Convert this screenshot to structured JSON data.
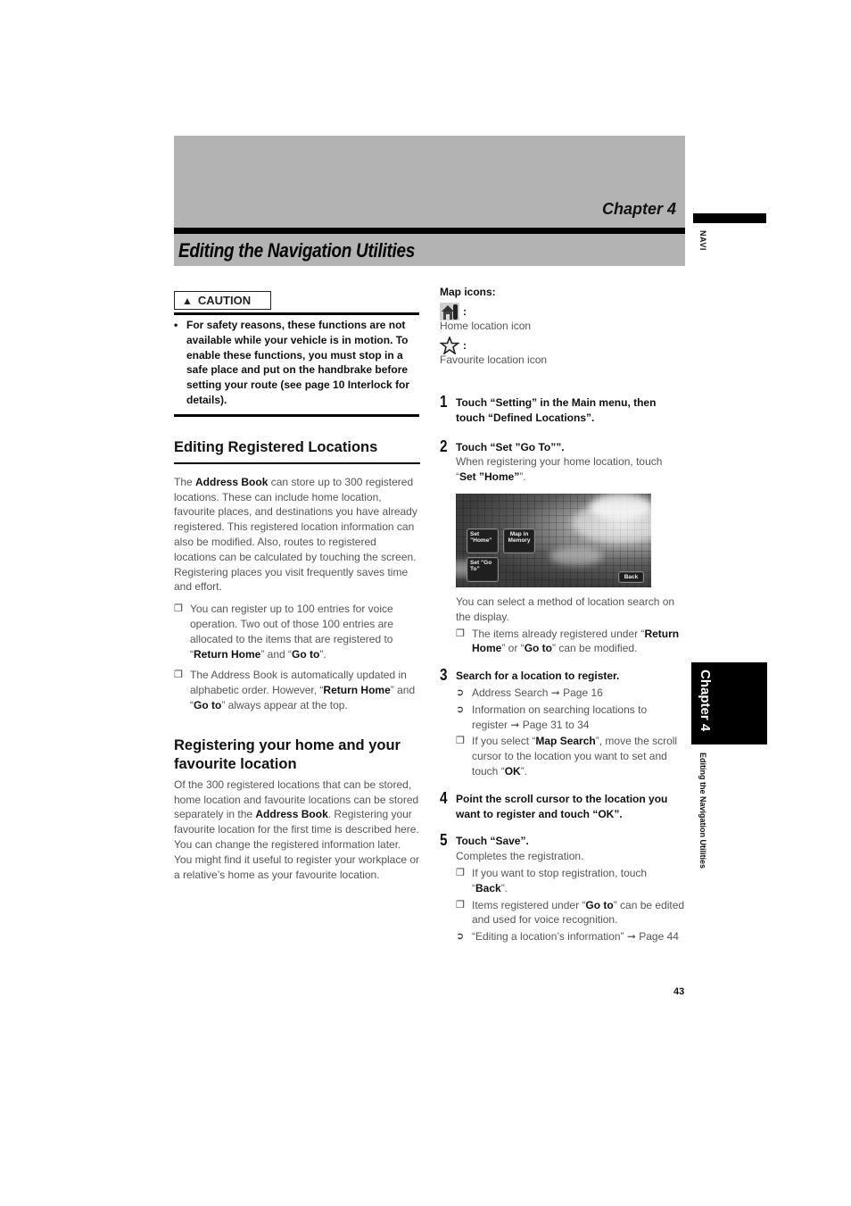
{
  "header": {
    "chapter": "Chapter 4",
    "title": "Editing the Navigation Utilities"
  },
  "side_tab": {
    "navi": "NAVI",
    "chapter": "Chapter 4",
    "section": "Editing the Navigation Utilities"
  },
  "caution": {
    "label": "CAUTION",
    "icon": "warning-triangle-icon",
    "text": "For safety reasons, these functions are not available while your vehicle is in motion. To enable these functions, you must stop in a safe place and put on the handbrake before setting your route (see page 10 Interlock for details)."
  },
  "section1": {
    "heading": "Editing Registered Locations",
    "intro_pre": "The ",
    "intro_bold": "Address Book",
    "intro_post": " can store up to 300 registered locations. These can include home location, favourite places, and destinations you have already registered. This registered location information can also be modified. Also, routes to registered locations can be calculated by touching the screen. Registering places you visit frequently saves time and effort.",
    "notes": [
      {
        "mark": "❐",
        "t1": "You can register up to 100 entries for voice operation. Two out of those 100 entries are allocated to the items that are registered to “",
        "b1": "Return Home",
        "t2": "” and “",
        "b2": "Go to",
        "t3": "”."
      },
      {
        "mark": "❐",
        "t1": "The Address Book is automatically updated in alphabetic order. However, “",
        "b1": "Return Home",
        "t2": "” and “",
        "b2": "Go to",
        "t3": "” always appear at the top."
      }
    ]
  },
  "section2": {
    "heading": "Registering your home and your favourite location",
    "t1": "Of the 300 registered locations that can be stored, home location and favourite locations can be stored separately in the ",
    "b1": "Address Book",
    "t2": ". Registering your favourite location for the first time is described here. You can change the registered information later. You might find it useful to register your workplace or a relative’s home as your favourite location."
  },
  "map_icons": {
    "title": "Map icons:",
    "items": [
      {
        "icon": "home-location-icon",
        "colon": ":",
        "caption": "Home location icon"
      },
      {
        "icon": "favourite-star-icon",
        "colon": ":",
        "caption": "Favourite location icon"
      }
    ]
  },
  "steps": [
    {
      "num": "1",
      "title": "Touch “Setting” in the Main menu, then touch “Defined Locations”."
    },
    {
      "num": "2",
      "title": "Touch “Set ”Go To””.",
      "desc_pre": "When registering your home location, touch “",
      "desc_bold": "Set ”Home”",
      "desc_post": "”.",
      "after_screen": "You can select a method of location search on the display.",
      "note": {
        "mark": "❐",
        "t1": "The items already registered under “",
        "b1": "Return Home",
        "t2": "” or “",
        "b2": "Go to",
        "t3": "” can be modified."
      }
    },
    {
      "num": "3",
      "title": "Search for a location to register.",
      "refs": [
        {
          "mark": "➲",
          "text": "Address Search ➞ Page 16"
        },
        {
          "mark": "➲",
          "text": "Information on searching locations to register ➞ Page 31 to 34"
        }
      ],
      "note": {
        "mark": "❐",
        "t1": "If you select “",
        "b1": "Map Search",
        "t2": "”, move the scroll cursor to the location you want to set and touch “",
        "b2": "OK",
        "t3": "”."
      }
    },
    {
      "num": "4",
      "title": "Point the scroll cursor to the location you want to register and touch “OK”."
    },
    {
      "num": "5",
      "title": "Touch “Save”.",
      "desc": "Completes the registration.",
      "notes": [
        {
          "mark": "❐",
          "t1": "If you want to stop registration, touch “",
          "b1": "Back",
          "t2": "”."
        },
        {
          "mark": "❐",
          "t1": "Items registered under “",
          "b1": "Go to",
          "t2": "” can be edited and used for voice recognition."
        }
      ],
      "ref": {
        "mark": "➲",
        "text": "“Editing a location’s information” ➞ Page 44"
      }
    }
  ],
  "screen": {
    "buttons": {
      "set_home": "Set ”Home”",
      "map_in_memory": "Map in Memory",
      "set_go_to": "Set ”Go To”",
      "back": "Back"
    }
  },
  "page_number": "43"
}
